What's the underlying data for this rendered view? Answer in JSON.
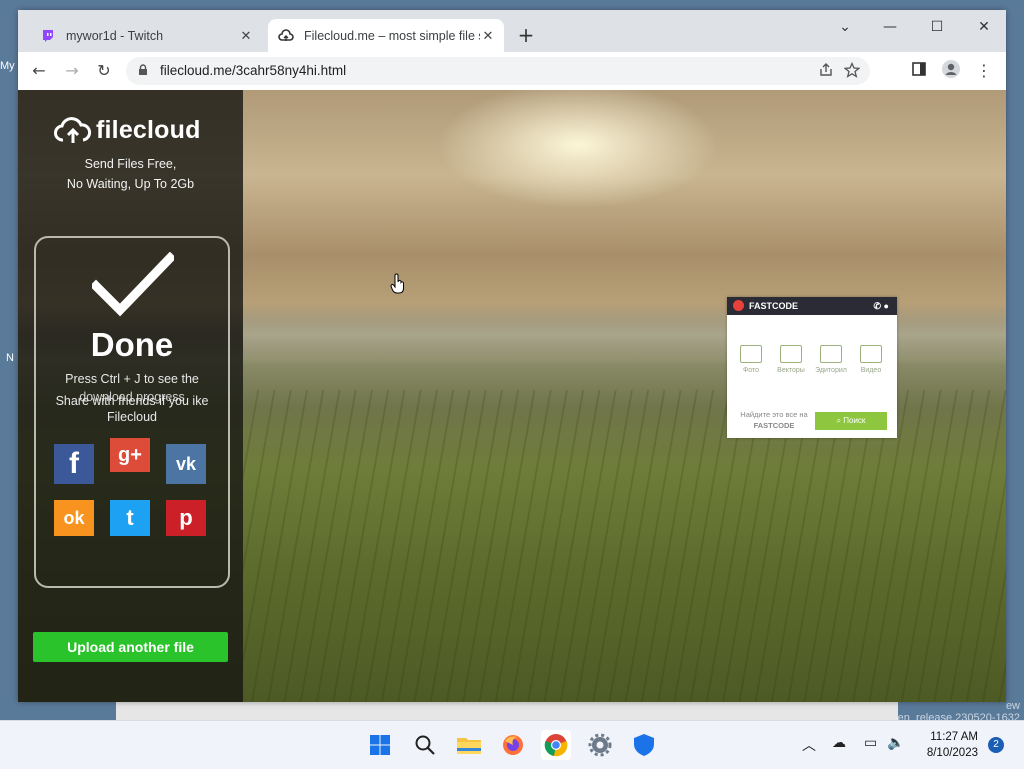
{
  "desktop": {
    "left_label_top": "My",
    "left_label_mid": "N",
    "bottom_right_text": "en_release.230520-1632",
    "bottom_right_text2": "ew"
  },
  "browser": {
    "tabs": [
      {
        "title": "mywor1d - Twitch",
        "favicon": "twitch-icon"
      },
      {
        "title": "Filecloud.me – most simple file s",
        "favicon": "cloud-icon",
        "active": true
      }
    ],
    "new_tab": "+",
    "window_controls": {
      "dropdown": "⌄",
      "minimize": "—",
      "maximize": "☐",
      "close": "✕"
    },
    "nav": {
      "back": "←",
      "forward": "→",
      "reload": "↻"
    },
    "url": "filecloud.me/3cahr58ny4hi.html"
  },
  "page": {
    "logo_text": "filecloud",
    "tagline_line1": "Send Files Free,",
    "tagline_line2": "No Waiting, Up To 2Gb",
    "status": "Done",
    "hint_line1": "Press Ctrl + J to see the",
    "hint_line2": "download progress",
    "share_line1": "Share with friends if you ike",
    "share_line2": "Filecloud",
    "social": [
      {
        "name": "facebook",
        "glyph": "f",
        "color": "#3b5998"
      },
      {
        "name": "google-plus",
        "glyph": "g+",
        "color": "#dd4b39"
      },
      {
        "name": "vk",
        "glyph": "vk",
        "color": "#4c75a3"
      },
      {
        "name": "odnoklassniki",
        "glyph": "ok",
        "color": "#f7931e"
      },
      {
        "name": "twitter",
        "glyph": "t",
        "color": "#1da1f2"
      },
      {
        "name": "pinterest",
        "glyph": "p",
        "color": "#cb2027"
      }
    ],
    "upload_button": "Upload another file"
  },
  "ad": {
    "brand": "FASTCODE",
    "items": [
      "Фото",
      "Векторы",
      "Эдиторил",
      "Видео"
    ],
    "text_line1": "Найдите это все на",
    "text_line2": "FASTCODE",
    "button": "Поиск"
  },
  "taskbar": {
    "time": "11:27 AM",
    "date": "8/10/2023",
    "notifications": "2"
  }
}
